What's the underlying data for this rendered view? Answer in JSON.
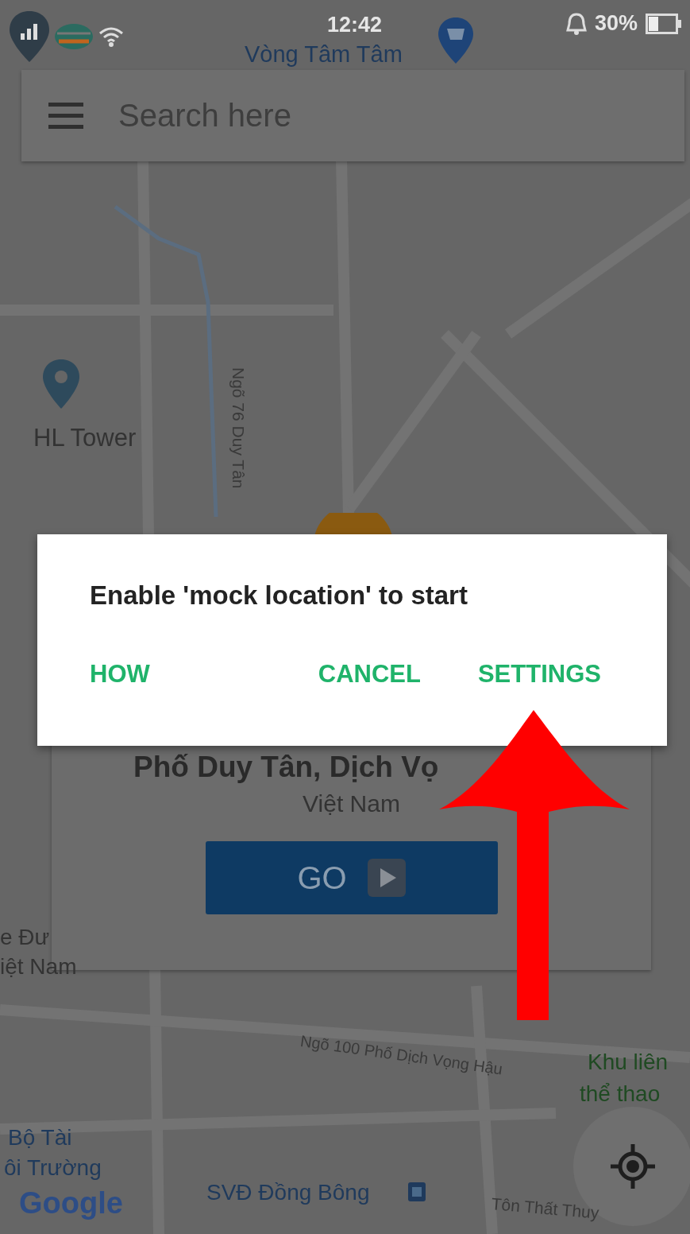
{
  "status_bar": {
    "time": "12:42",
    "battery": "30%"
  },
  "search": {
    "placeholder": "Search here"
  },
  "map_labels": [
    {
      "text": "Vòng Tâm Tâm",
      "kind": "poi"
    },
    {
      "text": "HL Tower",
      "kind": "place"
    },
    {
      "text": "Ngõ 76 Duy Tân",
      "kind": "street"
    },
    {
      "text": "e Đư",
      "kind": "place"
    },
    {
      "text": "iệt Nam",
      "kind": "place"
    },
    {
      "text": "Ngõ 100 Phố Dịch Vọng Hậu",
      "kind": "street"
    },
    {
      "text": "Khu liên",
      "kind": "park"
    },
    {
      "text": "thể thao",
      "kind": "park"
    },
    {
      "text": "Bộ Tài",
      "kind": "poi"
    },
    {
      "text": "ôi Trường",
      "kind": "poi"
    },
    {
      "text": "SVĐ Đồng Bông",
      "kind": "poi"
    },
    {
      "text": "Tôn Thất Thuy",
      "kind": "street"
    }
  ],
  "location_card": {
    "title": "Phố Duy Tân, Dịch Vọ",
    "subtitle": "Việt Nam",
    "button": "GO"
  },
  "attribution": "Google",
  "dialog": {
    "message": "Enable 'mock location' to start",
    "buttons": [
      "HOW",
      "CANCEL",
      "SETTINGS"
    ]
  }
}
